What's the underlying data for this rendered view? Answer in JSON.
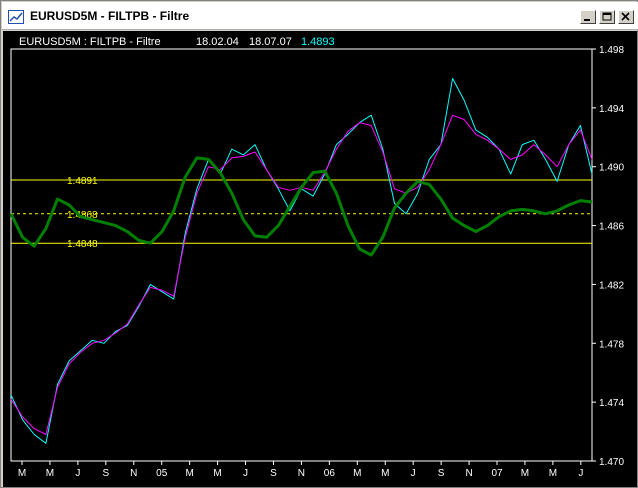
{
  "window": {
    "title": "EURUSD5M - FILTPB - Filtre",
    "buttons": [
      "minimize",
      "maximize",
      "close"
    ]
  },
  "chart_header": {
    "symbol_indicator": "EURUSD5M : FILTPB - Filtre",
    "date_from": "18.02.04",
    "date_to": "18.07.07",
    "last_value": "1.4893",
    "text_color": "#ffffff",
    "value_color": "#00ffff"
  },
  "colors": {
    "background": "#000000",
    "price_line": "#00ffff",
    "filter_line": "#ff00ff",
    "cycle_line": "#008000",
    "level_lines": "#ffff00",
    "axis": "#ffffff"
  },
  "chart_data": {
    "type": "line",
    "ylim": [
      1.47,
      1.498
    ],
    "y_ticks": [
      "1.498",
      "1.494",
      "1.490",
      "1.486",
      "1.482",
      "1.478",
      "1.474",
      "1.470"
    ],
    "x_ticks": [
      "M",
      "M",
      "J",
      "S",
      "N",
      "05",
      "M",
      "M",
      "J",
      "S",
      "N",
      "06",
      "M",
      "M",
      "J",
      "S",
      "N",
      "07",
      "M",
      "M",
      "J"
    ],
    "levels": [
      {
        "value": 1.4891,
        "label": "1.4891",
        "style": "solid"
      },
      {
        "value": 1.4868,
        "label": "1.4868",
        "style": "dashed"
      },
      {
        "value": 1.4848,
        "label": "1.4848",
        "style": "solid"
      }
    ],
    "series": [
      {
        "color": "#00ffff",
        "x": [
          0,
          2,
          4,
          6,
          8,
          10,
          12,
          14,
          16,
          18,
          20,
          22,
          24,
          26,
          28,
          30,
          32,
          34,
          36,
          38,
          40,
          42,
          44,
          46,
          48,
          50,
          52,
          54,
          56,
          58,
          60,
          62,
          64,
          66,
          68,
          70,
          72,
          74,
          76,
          78,
          80,
          82,
          84,
          86,
          88,
          90,
          92,
          94,
          96,
          98,
          100
        ],
        "y": [
          1.4745,
          1.4728,
          1.4718,
          1.4712,
          1.4752,
          1.4768,
          1.4775,
          1.4782,
          1.478,
          1.4788,
          1.4792,
          1.4805,
          1.482,
          1.4815,
          1.481,
          1.4855,
          1.4885,
          1.4905,
          1.4895,
          1.4912,
          1.4908,
          1.4915,
          1.4898,
          1.4885,
          1.487,
          1.4885,
          1.488,
          1.4895,
          1.4915,
          1.4922,
          1.493,
          1.4935,
          1.4912,
          1.4875,
          1.4868,
          1.4882,
          1.4905,
          1.4915,
          1.496,
          1.4945,
          1.4925,
          1.492,
          1.4912,
          1.4895,
          1.4915,
          1.4918,
          1.4905,
          1.489,
          1.4915,
          1.4928,
          1.4895
        ]
      },
      {
        "color": "#ff00ff",
        "x": [
          0,
          2,
          4,
          6,
          8,
          10,
          12,
          14,
          16,
          18,
          20,
          22,
          24,
          26,
          28,
          30,
          32,
          34,
          36,
          38,
          40,
          42,
          44,
          46,
          48,
          50,
          52,
          54,
          56,
          58,
          60,
          62,
          64,
          66,
          68,
          70,
          72,
          74,
          76,
          78,
          80,
          82,
          84,
          86,
          88,
          90,
          92,
          94,
          96,
          98,
          100
        ],
        "y": [
          1.4742,
          1.473,
          1.4722,
          1.4718,
          1.475,
          1.4766,
          1.4774,
          1.478,
          1.4782,
          1.4787,
          1.4793,
          1.4806,
          1.4818,
          1.4816,
          1.4812,
          1.4852,
          1.4882,
          1.49,
          1.4898,
          1.4906,
          1.4907,
          1.491,
          1.4898,
          1.4886,
          1.4884,
          1.4886,
          1.4884,
          1.4896,
          1.4912,
          1.4924,
          1.493,
          1.4928,
          1.491,
          1.4885,
          1.4882,
          1.4886,
          1.4898,
          1.4915,
          1.4935,
          1.4932,
          1.4922,
          1.4918,
          1.4912,
          1.4905,
          1.4908,
          1.4915,
          1.4908,
          1.49,
          1.4915,
          1.4925,
          1.4905
        ]
      },
      {
        "color": "#008000",
        "x": [
          0,
          2,
          4,
          6,
          8,
          10,
          12,
          14,
          16,
          18,
          20,
          22,
          24,
          26,
          28,
          30,
          32,
          34,
          36,
          38,
          40,
          42,
          44,
          46,
          48,
          50,
          52,
          54,
          56,
          58,
          60,
          62,
          64,
          66,
          68,
          70,
          72,
          74,
          76,
          78,
          80,
          82,
          84,
          86,
          88,
          90,
          92,
          94,
          96,
          98,
          100
        ],
        "y": [
          1.4868,
          1.4852,
          1.4846,
          1.4858,
          1.4878,
          1.4874,
          1.4866,
          1.4864,
          1.4862,
          1.486,
          1.4856,
          1.485,
          1.4848,
          1.4856,
          1.487,
          1.4893,
          1.4906,
          1.4905,
          1.4896,
          1.4882,
          1.4864,
          1.4853,
          1.4852,
          1.486,
          1.4873,
          1.4886,
          1.4896,
          1.4897,
          1.4882,
          1.486,
          1.4844,
          1.484,
          1.4852,
          1.4872,
          1.4882,
          1.489,
          1.4888,
          1.4878,
          1.4865,
          1.486,
          1.4856,
          1.486,
          1.4866,
          1.487,
          1.4871,
          1.487,
          1.4868,
          1.487,
          1.4874,
          1.4877,
          1.4876
        ]
      }
    ]
  }
}
